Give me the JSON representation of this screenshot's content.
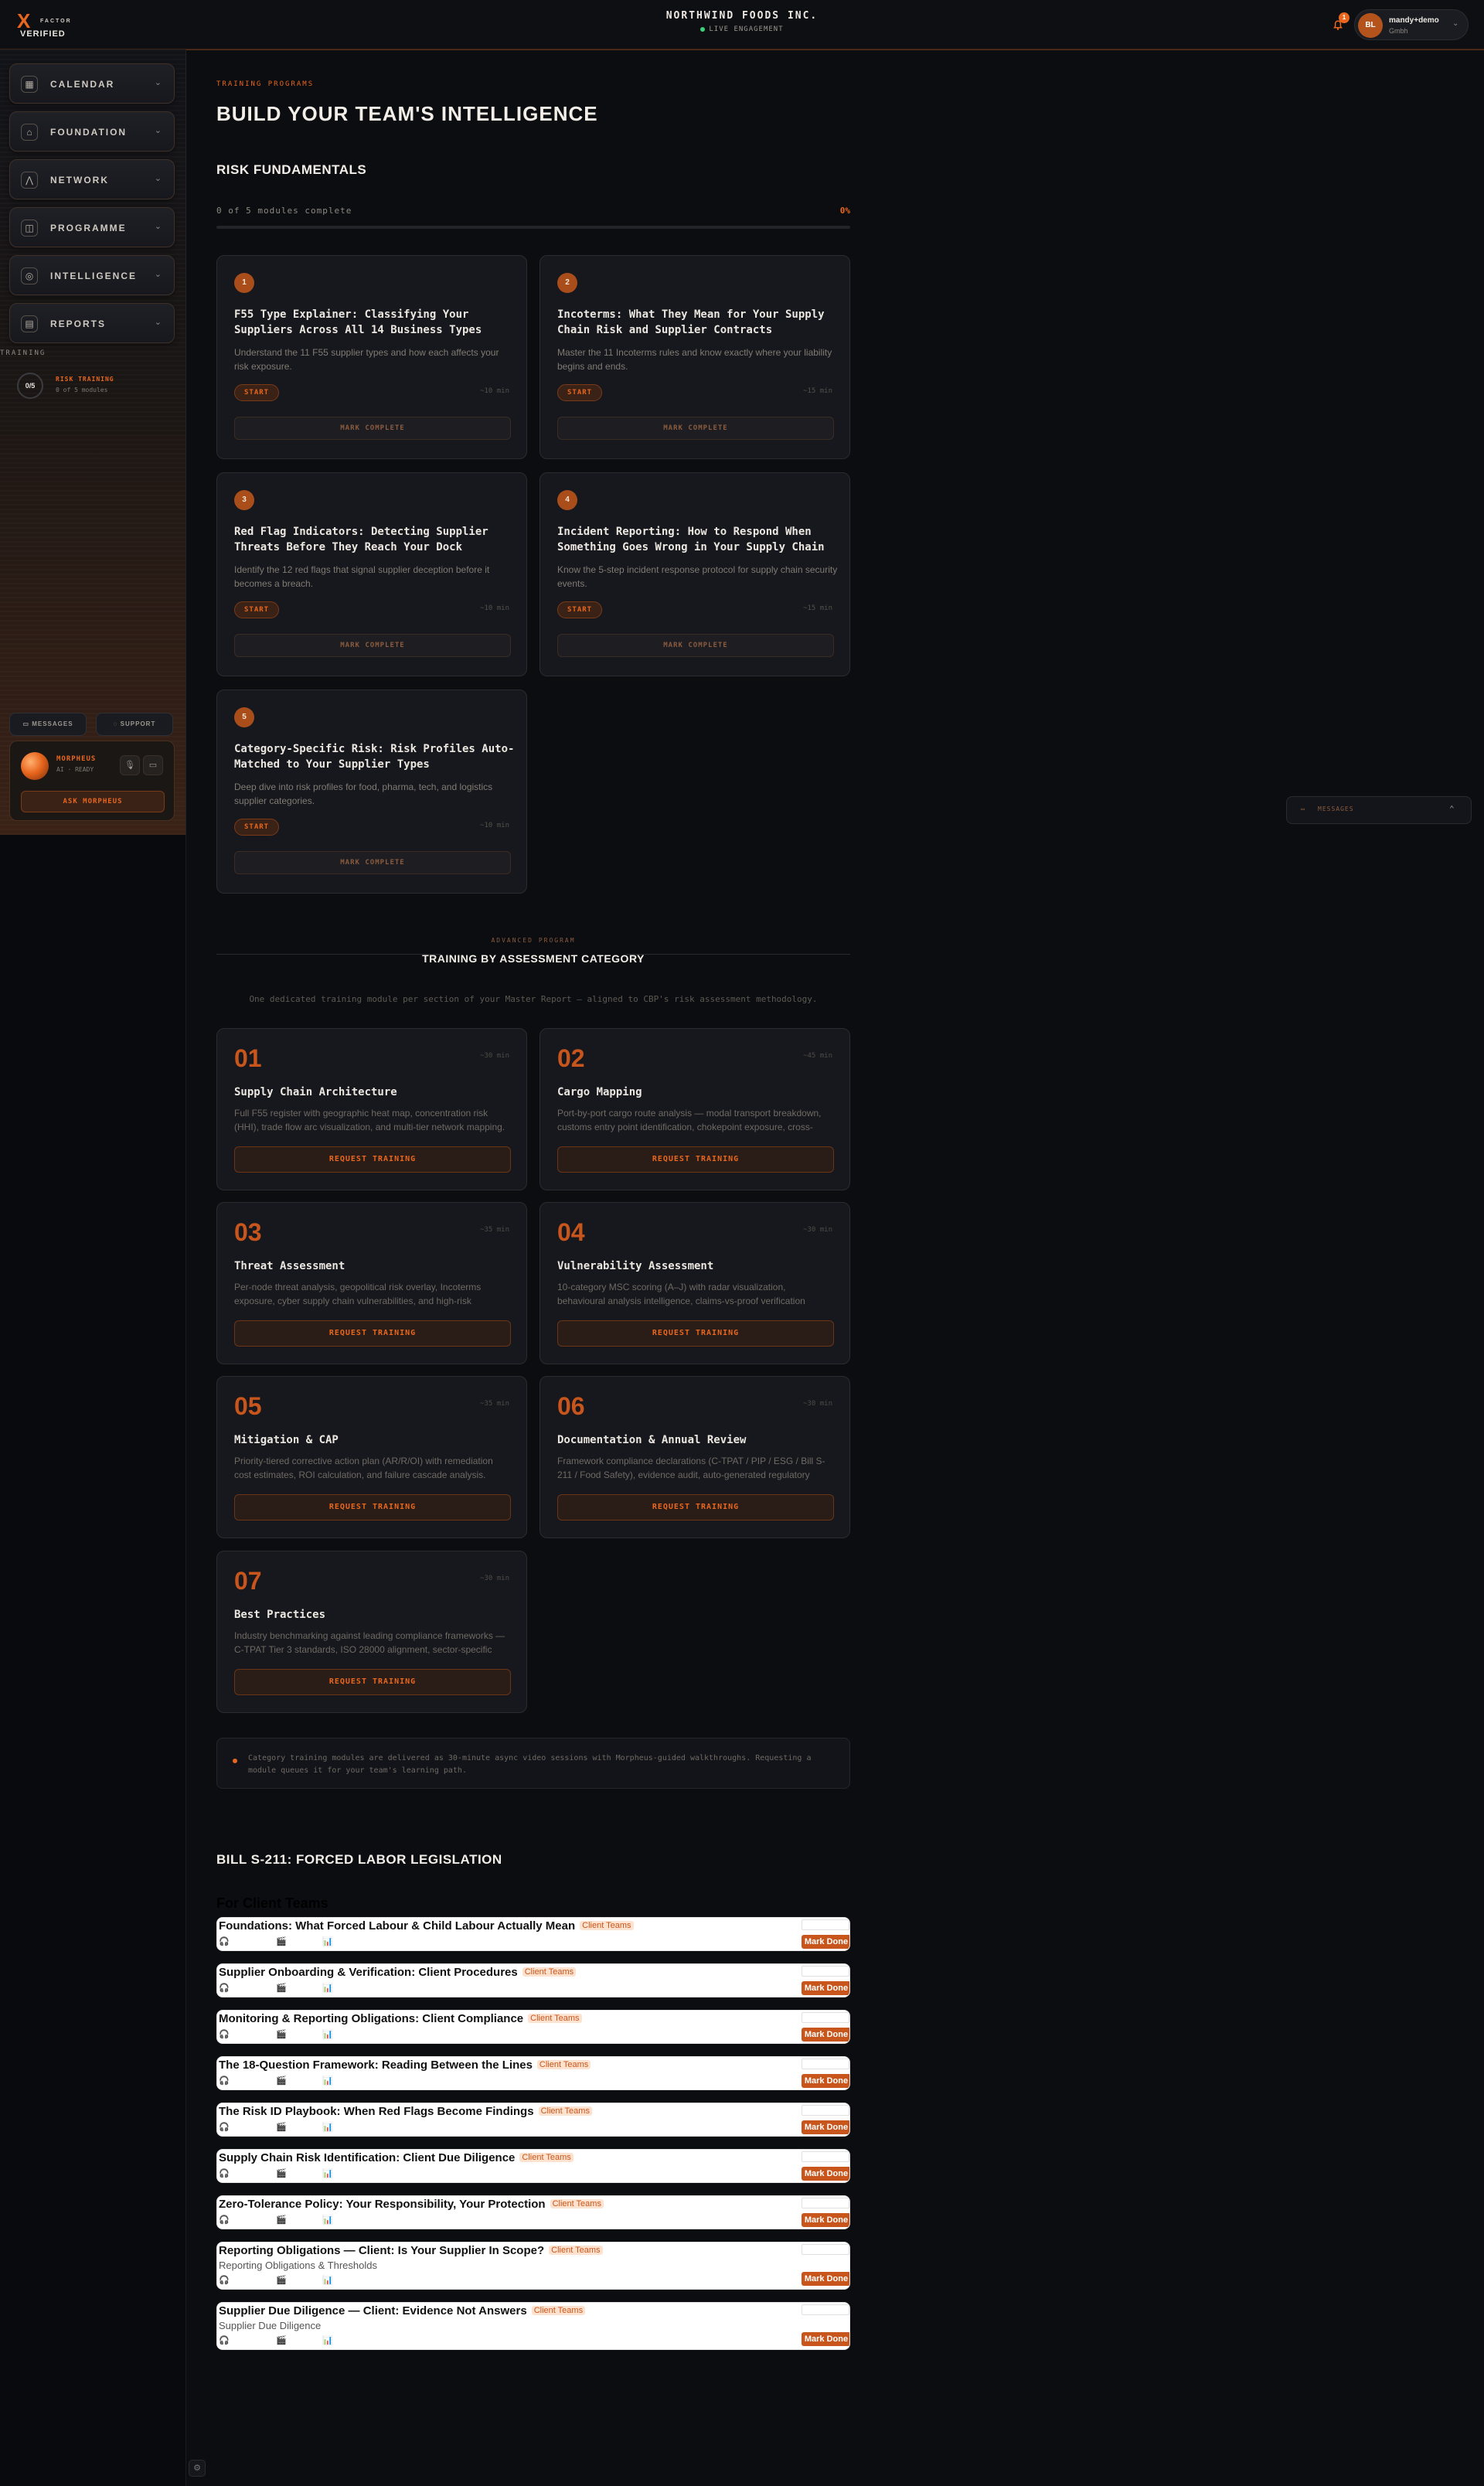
{
  "header": {
    "logo_mark": "X",
    "logo_top": "FACTOR",
    "logo_bottom": "VERIFIED",
    "company": "NORTHWIND FOODS INC.",
    "status": "LIVE ENGAGEMENT",
    "notifications": "1",
    "user_initials": "BL",
    "user_name": "mandy+demo",
    "user_role": "Gmbh"
  },
  "sidebar": {
    "items": [
      {
        "label": "CALENDAR",
        "icon": "calendar-icon"
      },
      {
        "label": "FOUNDATION",
        "icon": "home-icon"
      },
      {
        "label": "NETWORK",
        "icon": "network-icon"
      },
      {
        "label": "PROGRAMME",
        "icon": "book-icon"
      },
      {
        "label": "INTELLIGENCE",
        "icon": "globe-icon"
      },
      {
        "label": "REPORTS",
        "icon": "document-icon"
      }
    ],
    "section_label": "TRAINING",
    "progress": {
      "ring": "0/5",
      "title": "RISK TRAINING",
      "sub": "0 of 5 modules"
    },
    "messages_label": "MESSAGES",
    "support_label": "SUPPORT",
    "morpheus": {
      "name": "MORPHEUS",
      "status": "AI · READY",
      "ask": "ASK MORPHEUS"
    }
  },
  "floating_messages": "MESSAGES",
  "main": {
    "kicker": "TRAINING PROGRAMS",
    "title": "BUILD YOUR TEAM'S INTELLIGENCE",
    "section1": "RISK FUNDAMENTALS",
    "progress_text": "0 of 5 modules complete",
    "progress_pct": "0%",
    "progress_value": 0,
    "start_label": "START",
    "mark_label": "MARK COMPLETE",
    "modules": [
      {
        "num": "1",
        "title": "F55 Type Explainer: Classifying Your Suppliers Across All 14 Business Types",
        "desc": "Understand the 11 F55 supplier types and how each affects your risk exposure.",
        "dur": "~10 min"
      },
      {
        "num": "2",
        "title": "Incoterms: What They Mean for Your Supply Chain Risk and Supplier Contracts",
        "desc": "Master the 11 Incoterms rules and know exactly where your liability begins and ends.",
        "dur": "~15 min"
      },
      {
        "num": "3",
        "title": "Red Flag Indicators: Detecting Supplier Threats Before They Reach Your Dock",
        "desc": "Identify the 12 red flags that signal supplier deception before it becomes a breach.",
        "dur": "~10 min"
      },
      {
        "num": "4",
        "title": "Incident Reporting: How to Respond When Something Goes Wrong in Your Supply Chain",
        "desc": "Know the 5-step incident response protocol for supply chain security events.",
        "dur": "~15 min"
      },
      {
        "num": "5",
        "title": "Category-Specific Risk: Risk Profiles Auto-Matched to Your Supplier Types",
        "desc": "Deep dive into risk profiles for food, pharma, tech, and logistics supplier categories.",
        "dur": "~10 min"
      }
    ]
  },
  "advanced": {
    "kicker": "ADVANCED PROGRAM",
    "title": "TRAINING BY ASSESSMENT CATEGORY",
    "subtitle": "One dedicated training module per section of your Master Report — aligned to CBP's risk assessment methodology.",
    "request_label": "REQUEST TRAINING",
    "modules": [
      {
        "num": "01",
        "title": "Supply Chain Architecture",
        "desc": "Full F55 register with geographic heat map, concentration risk (HHI), trade flow arc visualization, and multi-tier network mapping.",
        "dur": "~30 min"
      },
      {
        "num": "02",
        "title": "Cargo Mapping",
        "desc": "Port-by-port cargo route analysis — modal transport breakdown, customs entry point identification, chokepoint exposure, cross-border handoffs.",
        "dur": "~45 min"
      },
      {
        "num": "03",
        "title": "Threat Assessment",
        "desc": "Per-node threat analysis, geopolitical risk overlay, Incoterms exposure, cyber supply chain vulnerabilities, and high-risk corridors.",
        "dur": "~35 min"
      },
      {
        "num": "04",
        "title": "Vulnerability Assessment",
        "desc": "10-category MSC scoring (A–J) with radar visualization, behavioural analysis intelligence, claims-vs-proof verification matrix.",
        "dur": "~30 min"
      },
      {
        "num": "05",
        "title": "Mitigation & CAP",
        "desc": "Priority-tiered corrective action plan (AR/R/OI) with remediation cost estimates, ROI calculation, and failure cascade analysis.",
        "dur": "~35 min"
      },
      {
        "num": "06",
        "title": "Documentation & Annual Review",
        "desc": "Framework compliance declarations (C-TPAT / PIP / ESG / Bill S-211 / Food Safety), evidence audit, auto-generated regulatory filings.",
        "dur": "~30 min"
      },
      {
        "num": "07",
        "title": "Best Practices",
        "desc": "Industry benchmarking against leading compliance frameworks — C-TPAT Tier 3 standards, ISO 28000 alignment, sector-specific playbooks.",
        "dur": "~30 min"
      }
    ],
    "note": "Category training modules are delivered as 30-minute async video sessions with Morpheus-guided walkthroughs. Requesting a module queues it for your team's learning path."
  },
  "bill": {
    "title": "BILL S-211: FORCED LABOR LEGISLATION",
    "subtitle": "For Client Teams",
    "tag": "Client Teams",
    "done_label": "Mark Done",
    "lessons": [
      {
        "title": "Foundations: What Forced Labour & Child Labour Actually Mean",
        "sub": ""
      },
      {
        "title": "Supplier Onboarding & Verification: Client Procedures",
        "sub": ""
      },
      {
        "title": "Monitoring & Reporting Obligations: Client Compliance",
        "sub": ""
      },
      {
        "title": "The 18-Question Framework: Reading Between the Lines",
        "sub": ""
      },
      {
        "title": "The Risk ID Playbook: When Red Flags Become Findings",
        "sub": ""
      },
      {
        "title": "Supply Chain Risk Identification: Client Due Diligence",
        "sub": ""
      },
      {
        "title": "Zero-Tolerance Policy: Your Responsibility, Your Protection",
        "sub": ""
      },
      {
        "title": "Reporting Obligations — Client: Is Your Supplier In Scope?",
        "sub": "Reporting Obligations & Thresholds"
      },
      {
        "title": "Supplier Due Diligence — Client: Evidence Not Answers",
        "sub": "Supplier Due Diligence"
      }
    ]
  }
}
